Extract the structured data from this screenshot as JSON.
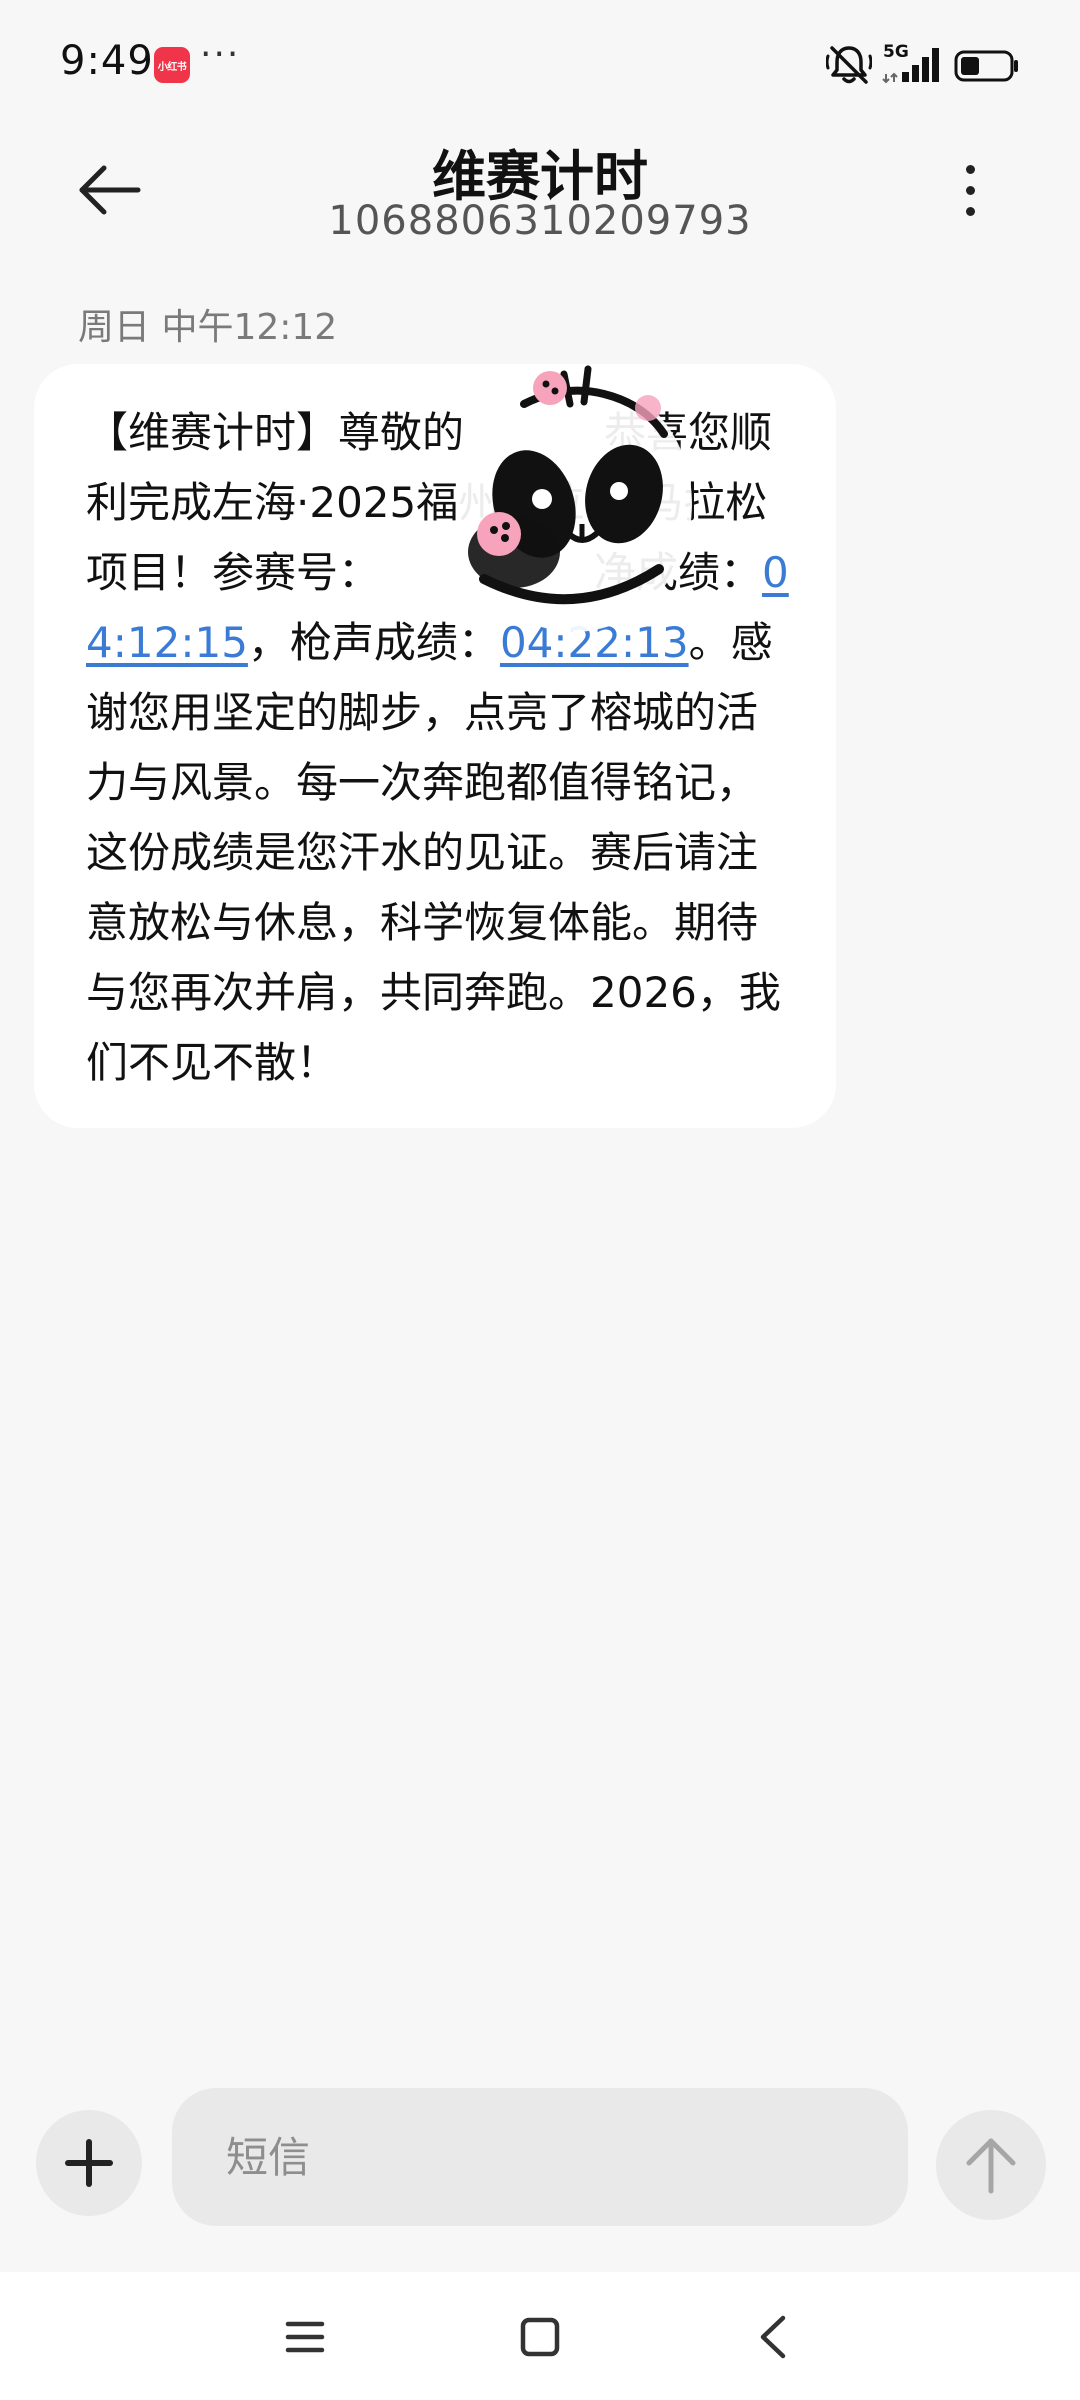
{
  "status_bar": {
    "time": "9:49",
    "app_icon_label": "小红书",
    "more_glyph": "···",
    "network_label": "5G",
    "icons": [
      "xiaohongshu-app-icon",
      "mute-icon",
      "signal-icon",
      "battery-icon"
    ]
  },
  "header": {
    "title": "维赛计时",
    "subtitle": "1068806310209793",
    "back_icon": "back-arrow-icon",
    "more_icon": "more-vertical-icon"
  },
  "thread": {
    "timestamp": "周日 中午12:12",
    "message": {
      "segments": {
        "s1": "【维赛计时】尊敬的",
        "s2": "恭喜您顺利完成左海·2025福州马拉松-马拉松项目！参赛号：",
        "s3": "净成绩：",
        "net_time": "04:12:15",
        "s4": "，枪声成绩：",
        "gun_time": "04:22:13",
        "s5": "。感谢您用坚定的脚步，点亮了榕城的活力与风景。每一次奔跑都值得铭记，这份成绩是您汗水的见证。赛后请注意放松与休息，科学恢复体能。期待与您再次并肩，共同奔跑。2026，我们不见不散！"
      },
      "sticker": "panda-sticker-overlay",
      "link_color": "#3a7bd5"
    }
  },
  "composer": {
    "placeholder": "短信",
    "add_icon": "plus-icon",
    "send_icon": "send-arrow-icon"
  },
  "nav": {
    "icons": [
      "menu-icon",
      "home-icon",
      "back-icon"
    ]
  },
  "colors": {
    "background": "#f7f7f7",
    "bubble": "#ffffff",
    "input": "#e9e9e9",
    "brand_red": "#f0344a"
  }
}
